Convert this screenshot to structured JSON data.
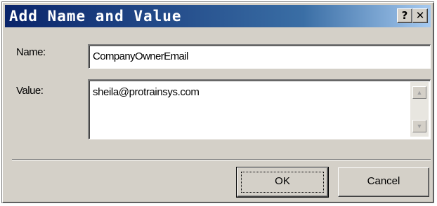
{
  "window": {
    "title": "Add Name and Value",
    "help_glyph": "?",
    "close_glyph": "✕"
  },
  "form": {
    "name_label": "Name:",
    "name_value": "CompanyOwnerEmail",
    "value_label": "Value:",
    "value_text": "sheila@protrainsys.com"
  },
  "scrollbar": {
    "up_glyph": "▲",
    "down_glyph": "▼"
  },
  "buttons": {
    "ok_label": "OK",
    "cancel_label": "Cancel"
  }
}
